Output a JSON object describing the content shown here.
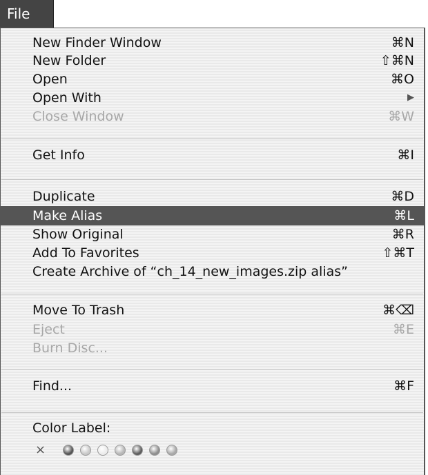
{
  "menubar": {
    "title": "File"
  },
  "menu": {
    "groups": [
      [
        {
          "label": "New Finder Window",
          "shortcut": "⌘N",
          "disabled": false
        },
        {
          "label": "New Folder",
          "shortcut": "⇧⌘N",
          "disabled": false
        },
        {
          "label": "Open",
          "shortcut": "⌘O",
          "disabled": false
        },
        {
          "label": "Open With",
          "shortcut": "▶",
          "disabled": false
        },
        {
          "label": "Close Window",
          "shortcut": "⌘W",
          "disabled": true
        }
      ],
      [
        {
          "label": "Get Info",
          "shortcut": "⌘I",
          "disabled": false
        }
      ],
      [
        {
          "label": "Duplicate",
          "shortcut": "⌘D",
          "disabled": false
        },
        {
          "label": "Make Alias",
          "shortcut": "⌘L",
          "disabled": false,
          "highlighted": true
        },
        {
          "label": "Show Original",
          "shortcut": "⌘R",
          "disabled": false
        },
        {
          "label": "Add To Favorites",
          "shortcut": "⇧⌘T",
          "disabled": false
        },
        {
          "label": "Create Archive of “ch_14_new_images.zip alias”",
          "shortcut": "",
          "disabled": false
        }
      ],
      [
        {
          "label": "Move To Trash",
          "shortcut": "⌘⌫",
          "disabled": false
        },
        {
          "label": "Eject",
          "shortcut": "⌘E",
          "disabled": true
        },
        {
          "label": "Burn Disc...",
          "shortcut": "",
          "disabled": true
        }
      ],
      [
        {
          "label": "Find...",
          "shortcut": "⌘F",
          "disabled": false
        }
      ]
    ],
    "color_label": {
      "title": "Color Label:",
      "none_symbol": "×",
      "swatches": [
        {
          "name": "red",
          "color": "#555555"
        },
        {
          "name": "orange",
          "color": "#c9c9c9"
        },
        {
          "name": "yellow",
          "color": "#ececec"
        },
        {
          "name": "green",
          "color": "#b7b7b7"
        },
        {
          "name": "blue",
          "color": "#5e5e5e"
        },
        {
          "name": "purple",
          "color": "#8e8e8e"
        },
        {
          "name": "gray",
          "color": "#a9a9a9"
        }
      ]
    }
  },
  "colors": {
    "highlight": "#555555",
    "text": "#111111",
    "disabled_text": "#a7a7a7"
  }
}
